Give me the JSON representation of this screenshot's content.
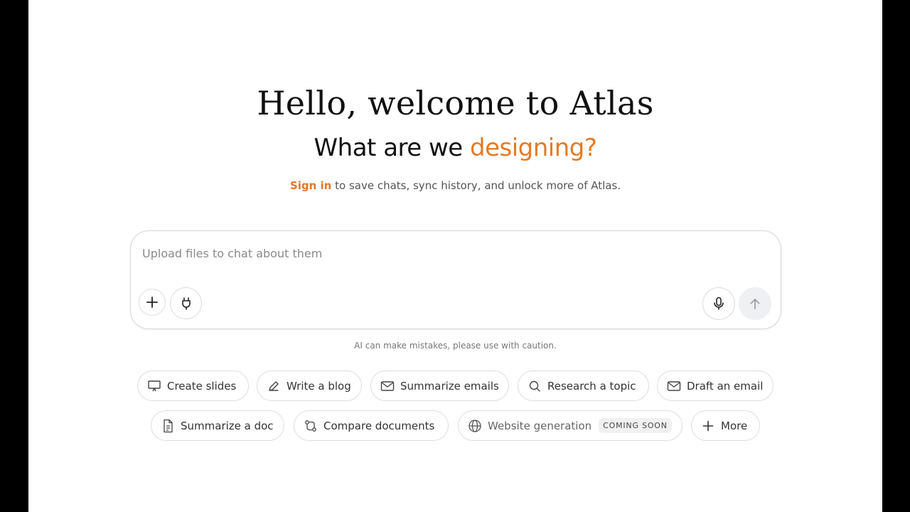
{
  "hero": {
    "title": "Hello, welcome to Atlas",
    "subtitle_prefix": "What are we ",
    "subtitle_accent": "designing?",
    "signin_link": "Sign in",
    "signin_rest": " to save chats, sync history, and unlock more of Atlas."
  },
  "composer": {
    "placeholder": "Upload files to chat about them",
    "value": "",
    "add_icon": "plus-icon",
    "plugin_icon": "plug-icon",
    "mic_icon": "microphone-icon",
    "send_icon": "arrow-up-icon"
  },
  "disclaimer": "AI can make mistakes, please use with caution.",
  "suggestions": {
    "row1": [
      {
        "label": "Create slides",
        "icon": "presentation-icon"
      },
      {
        "label": "Write a blog",
        "icon": "pencil-icon"
      },
      {
        "label": "Summarize emails",
        "icon": "mail-icon"
      },
      {
        "label": "Research a topic",
        "icon": "search-icon"
      },
      {
        "label": "Draft an email",
        "icon": "mail-icon"
      }
    ],
    "row2": [
      {
        "label": "Summarize a doc",
        "icon": "document-icon"
      },
      {
        "label": "Compare documents",
        "icon": "compare-icon"
      },
      {
        "label": "Website generation",
        "icon": "globe-icon",
        "badge": "COMING SOON"
      },
      {
        "label": "More",
        "icon": "plus-icon"
      }
    ]
  },
  "colors": {
    "accent": "#e57a26",
    "background": "#ffffff",
    "border": "#dedede"
  }
}
